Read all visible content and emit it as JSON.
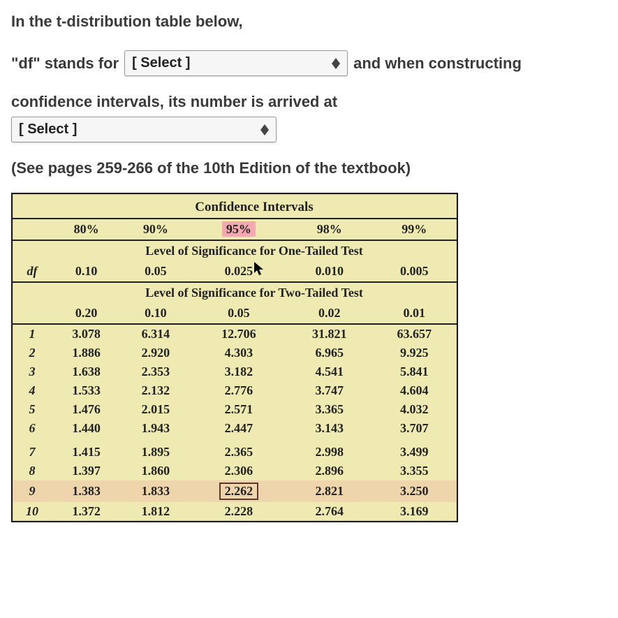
{
  "intro": "In the t-distribution table below,",
  "line1_pre": "\"df\" stands for",
  "select1": "[ Select ]",
  "line1_post": "and when constructing",
  "line2_pre": "confidence intervals, its number is arrived at",
  "select2": "[ Select ]",
  "reference": "(See pages 259-266 of the 10th Edition of the textbook)",
  "table": {
    "title": "Confidence Intervals",
    "ci": [
      "80%",
      "90%",
      "95%",
      "98%",
      "99%"
    ],
    "one_tailed_label": "Level of Significance for One-Tailed Test",
    "one_tailed": [
      "0.10",
      "0.05",
      "0.025",
      "0.010",
      "0.005"
    ],
    "two_tailed_label": "Level of Significance for Two-Tailed Test",
    "two_tailed": [
      "0.20",
      "0.10",
      "0.05",
      "0.02",
      "0.01"
    ],
    "df_label": "df",
    "rows": [
      {
        "df": "1",
        "v": [
          "3.078",
          "6.314",
          "12.706",
          "31.821",
          "63.657"
        ]
      },
      {
        "df": "2",
        "v": [
          "1.886",
          "2.920",
          "4.303",
          "6.965",
          "9.925"
        ]
      },
      {
        "df": "3",
        "v": [
          "1.638",
          "2.353",
          "3.182",
          "4.541",
          "5.841"
        ]
      },
      {
        "df": "4",
        "v": [
          "1.533",
          "2.132",
          "2.776",
          "3.747",
          "4.604"
        ]
      },
      {
        "df": "5",
        "v": [
          "1.476",
          "2.015",
          "2.571",
          "3.365",
          "4.032"
        ]
      },
      {
        "df": "6",
        "v": [
          "1.440",
          "1.943",
          "2.447",
          "3.143",
          "3.707"
        ]
      },
      {
        "df": "7",
        "v": [
          "1.415",
          "1.895",
          "2.365",
          "2.998",
          "3.499"
        ]
      },
      {
        "df": "8",
        "v": [
          "1.397",
          "1.860",
          "2.306",
          "2.896",
          "3.355"
        ]
      },
      {
        "df": "9",
        "v": [
          "1.383",
          "1.833",
          "2.262",
          "2.821",
          "3.250"
        ]
      },
      {
        "df": "10",
        "v": [
          "1.372",
          "1.812",
          "2.228",
          "2.764",
          "3.169"
        ]
      }
    ]
  },
  "chart_data": {
    "type": "table",
    "title": "t-distribution critical values",
    "columns": [
      "df",
      "80% CI / α1=0.10 / α2=0.20",
      "90% CI / α1=0.05 / α2=0.10",
      "95% CI / α1=0.025 / α2=0.05",
      "98% CI / α1=0.010 / α2=0.02",
      "99% CI / α1=0.005 / α2=0.01"
    ],
    "rows": [
      [
        1,
        3.078,
        6.314,
        12.706,
        31.821,
        63.657
      ],
      [
        2,
        1.886,
        2.92,
        4.303,
        6.965,
        9.925
      ],
      [
        3,
        1.638,
        2.353,
        3.182,
        4.541,
        5.841
      ],
      [
        4,
        1.533,
        2.132,
        2.776,
        3.747,
        4.604
      ],
      [
        5,
        1.476,
        2.015,
        2.571,
        3.365,
        4.032
      ],
      [
        6,
        1.44,
        1.943,
        2.447,
        3.143,
        3.707
      ],
      [
        7,
        1.415,
        1.895,
        2.365,
        2.998,
        3.499
      ],
      [
        8,
        1.397,
        1.86,
        2.306,
        2.896,
        3.355
      ],
      [
        9,
        1.383,
        1.833,
        2.262,
        2.821,
        3.25
      ],
      [
        10,
        1.372,
        1.812,
        2.228,
        2.764,
        3.169
      ]
    ],
    "highlighted_column": 2,
    "highlighted_row_index": 8,
    "boxed_cell": {
      "row": 8,
      "col": 2,
      "value": 2.262
    }
  }
}
